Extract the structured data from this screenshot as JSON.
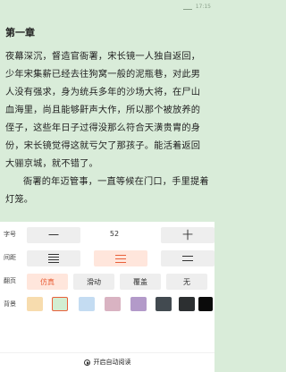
{
  "status_bar": {
    "time": "17:15"
  },
  "reader": {
    "chapter_title": "第一章",
    "paragraphs": [
      "夜幕深沉，督造官衙署，宋长镜一人独自返回，少年宋集薪已经去往狗窝一般的泥瓶巷，对此男人没有强求，身为统兵多年的沙场大将，在尸山血海里，尚且能够鼾声大作，所以那个被放养的侄子，这些年日子过得没那么符合天潢贵胄的身份，宋长镜觉得这就亏欠了那孩子。能活着返回大骊京城，就不错了。",
      "衙署的年迈管事，一直等候在门口，手里提着灯笼。"
    ]
  },
  "settings": {
    "font_size": {
      "label": "字号",
      "decrease": "一",
      "increase": "十",
      "value": "52"
    },
    "spacing": {
      "label": "间距",
      "options": [
        "tight",
        "medium",
        "loose"
      ],
      "selected": 1
    },
    "page_turn": {
      "label": "翻页",
      "options": [
        "仿真",
        "滑动",
        "覆盖",
        "无"
      ],
      "selected": 0
    },
    "background": {
      "label": "背景",
      "colors": [
        "#f7dcae",
        "#d2eed2",
        "#c4dcf2",
        "#d9b3c2",
        "#b39ac9",
        "#424a50",
        "#2c2f31",
        "#0b0b0b"
      ],
      "selected": 1
    },
    "auto_read": {
      "label": "开启自动阅读"
    }
  }
}
